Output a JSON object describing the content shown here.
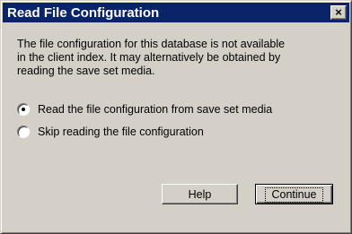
{
  "window": {
    "title": "Read File Configuration",
    "close_glyph": "×"
  },
  "message": "The file configuration for this database is not available\nin the client index.  It may alternatively be obtained by\nreading the save set media.",
  "options": [
    {
      "label": "Read the file configuration from save set media",
      "selected": true
    },
    {
      "label": "Skip reading the file configuration",
      "selected": false
    }
  ],
  "buttons": {
    "help": "Help",
    "continue": "Continue"
  },
  "colors": {
    "titlebar": "#0a246a",
    "face": "#d4d0c8"
  }
}
